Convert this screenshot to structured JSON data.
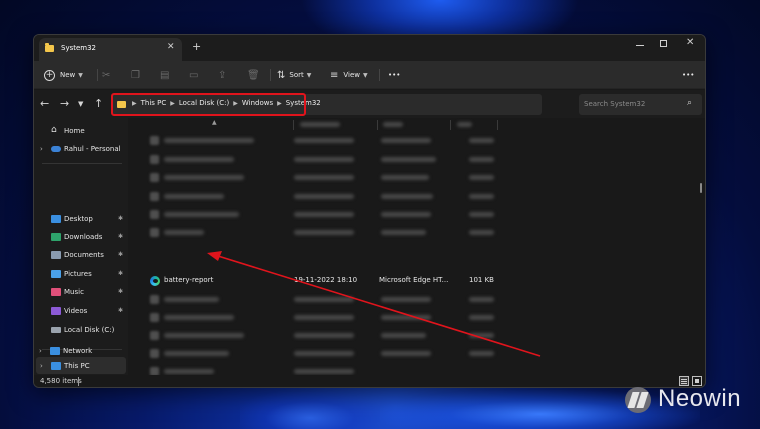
{
  "window": {
    "tab_title": "System32",
    "tab_close": "✕",
    "new_tab": "+"
  },
  "toolbar": {
    "new_label": "New",
    "sort_label": "Sort",
    "view_label": "View",
    "more_label": "•••",
    "right_more_label": "•••"
  },
  "address": {
    "breadcrumbs": [
      "This PC",
      "Local Disk (C:)",
      "Windows",
      "System32"
    ],
    "search_placeholder": "Search System32"
  },
  "sidebar": {
    "items": [
      {
        "label": "Home",
        "icon": "home-icon"
      },
      {
        "label": "Rahul - Personal",
        "icon": "onedrive-cloud-icon"
      },
      {
        "label": "Desktop",
        "icon": "desktop-folder-icon"
      },
      {
        "label": "Downloads",
        "icon": "downloads-folder-icon"
      },
      {
        "label": "Documents",
        "icon": "documents-folder-icon"
      },
      {
        "label": "Pictures",
        "icon": "pictures-folder-icon"
      },
      {
        "label": "Music",
        "icon": "music-folder-icon"
      },
      {
        "label": "Videos",
        "icon": "videos-folder-icon"
      },
      {
        "label": "Local Disk (C:)",
        "icon": "drive-icon"
      },
      {
        "label": "This PC",
        "icon": "computer-icon"
      },
      {
        "label": "Network",
        "icon": "network-icon"
      }
    ]
  },
  "file": {
    "name": "battery-report",
    "date": "19-11-2022 18:10",
    "type": "Microsoft Edge HT...",
    "size": "101 KB"
  },
  "status": {
    "item_count": "4,580 items"
  },
  "watermark": {
    "text": "Neowin"
  },
  "colors": {
    "highlight_red": "#e0141c",
    "folder_yellow": "#f3c64b",
    "window_bg": "#191919",
    "toolbar_bg": "#2b2b2b"
  }
}
